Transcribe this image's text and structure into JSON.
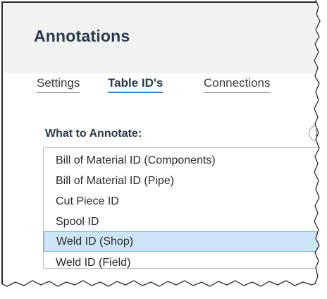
{
  "panel": {
    "title": "Annotations"
  },
  "tabs": [
    {
      "label": "Settings",
      "active": false
    },
    {
      "label": "Table ID's",
      "active": true
    },
    {
      "label": "Connections",
      "active": false
    }
  ],
  "annotate": {
    "label": "What to Annotate:",
    "info_icon": "info-icon",
    "items": [
      {
        "label": "Bill of Material ID (Components)",
        "selected": false
      },
      {
        "label": "Bill of Material ID (Pipe)",
        "selected": false
      },
      {
        "label": "Cut Piece ID",
        "selected": false
      },
      {
        "label": "Spool ID",
        "selected": false
      },
      {
        "label": "Weld ID (Shop)",
        "selected": true
      },
      {
        "label": "Weld ID (Field)",
        "selected": false
      }
    ]
  },
  "colors": {
    "accent": "#2f7fd0",
    "selection": "#cde6f7",
    "header_bg": "#f2f2f2"
  }
}
